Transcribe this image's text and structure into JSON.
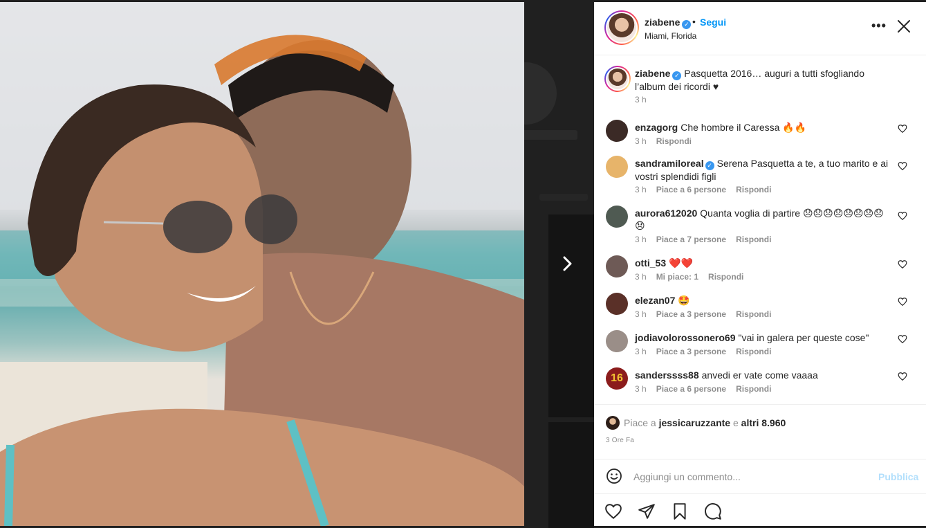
{
  "post": {
    "username": "ziabene",
    "follow_label": "Segui",
    "location": "Miami, Florida",
    "separator": "•",
    "caption": "Pasquetta 2016… auguri a tutti sfogliando l’album dei ricordi ♥",
    "caption_time": "3 h"
  },
  "comments": [
    {
      "user": "enzagorg",
      "text": "Che hombre il Caressa 🔥🔥",
      "time": "3 h",
      "likes": "",
      "reply": "Rispondi",
      "avatar_color": "#3b2a26"
    },
    {
      "user": "sandramiloreal",
      "text": "Serena Pasquetta a te, a tuo marito e ai vostri splendidi figli",
      "time": "3 h",
      "likes": "Piace a 6 persone",
      "reply": "Rispondi",
      "avatar_color": "#e7b46a"
    },
    {
      "user": "aurora612020",
      "text": "Quanta voglia di partire 😞😞😞😞😞😞😞😞😞",
      "time": "3 h",
      "likes": "Piace a 7 persone",
      "reply": "Rispondi",
      "avatar_color": "#4f5a52"
    },
    {
      "user": "otti_53",
      "text": "❤️❤️",
      "time": "3 h",
      "likes": "Mi piace: 1",
      "reply": "Rispondi",
      "avatar_color": "#6e5a56"
    },
    {
      "user": "elezan07",
      "text": "🤩",
      "time": "3 h",
      "likes": "Piace a 3 persone",
      "reply": "Rispondi",
      "avatar_color": "#5a3028"
    },
    {
      "user": "jodiavolorossonero69",
      "text": "\"vai in galera per queste cose\"",
      "time": "3 h",
      "likes": "Piace a 3 persone",
      "reply": "Rispondi",
      "avatar_color": "#9a8e88"
    },
    {
      "user": "sanderssss88",
      "text": "anvedi er vate come vaaaa",
      "time": "3 h",
      "likes": "Piace a 6 persone",
      "reply": "Rispondi",
      "avatar_color": "#8b1c1c",
      "avatar_label": "16"
    }
  ],
  "footer": {
    "likes_prefix": "Piace a",
    "likes_user": "jessicaruzzante",
    "likes_mid": "e",
    "likes_others": "altri 8.960",
    "time_ago": "3 Ore Fa",
    "comment_placeholder": "Aggiungi un commento...",
    "publish_label": "Pubblica"
  },
  "colors": {
    "accent": "#0095f6",
    "verified": "#3897f0",
    "publish_disabled": "#b2dffc"
  },
  "icons": {
    "more": "more-icon",
    "close": "close-icon",
    "heart": "heart-icon",
    "comment": "comment-icon",
    "share": "share-icon",
    "save": "bookmark-icon",
    "emoji": "emoji-icon",
    "next": "chevron-right-icon"
  }
}
